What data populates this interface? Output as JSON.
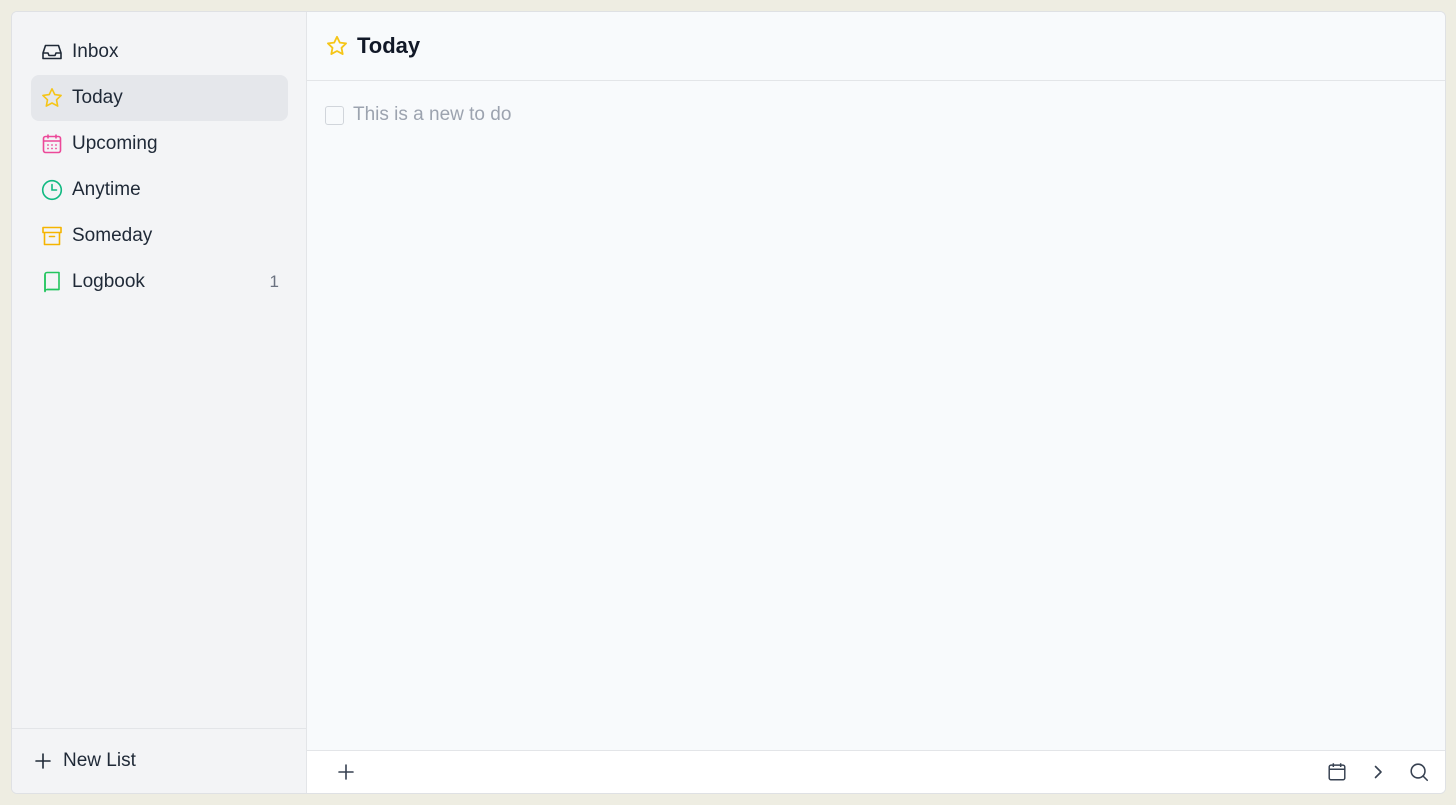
{
  "sidebar": {
    "items": [
      {
        "label": "Inbox",
        "icon": "inbox-icon",
        "color": "#1f2937",
        "count": ""
      },
      {
        "label": "Today",
        "icon": "star-icon",
        "color": "#f5c518",
        "count": ""
      },
      {
        "label": "Upcoming",
        "icon": "calendar-icon",
        "color": "#ec4899",
        "count": ""
      },
      {
        "label": "Anytime",
        "icon": "clock-icon",
        "color": "#10b981",
        "count": ""
      },
      {
        "label": "Someday",
        "icon": "archive-icon",
        "color": "#f5b400",
        "count": ""
      },
      {
        "label": "Logbook",
        "icon": "book-icon",
        "color": "#22c55e",
        "count": "1"
      }
    ],
    "active_index": 1,
    "new_list_label": "New List"
  },
  "main": {
    "title": "Today",
    "title_icon": "star-icon",
    "todos": [
      {
        "text": "This is a new to do",
        "checked": false
      }
    ]
  },
  "footer": {
    "add_icon": "plus-icon",
    "tools": [
      "calendar-icon",
      "chevron-right-icon",
      "search-icon"
    ]
  }
}
